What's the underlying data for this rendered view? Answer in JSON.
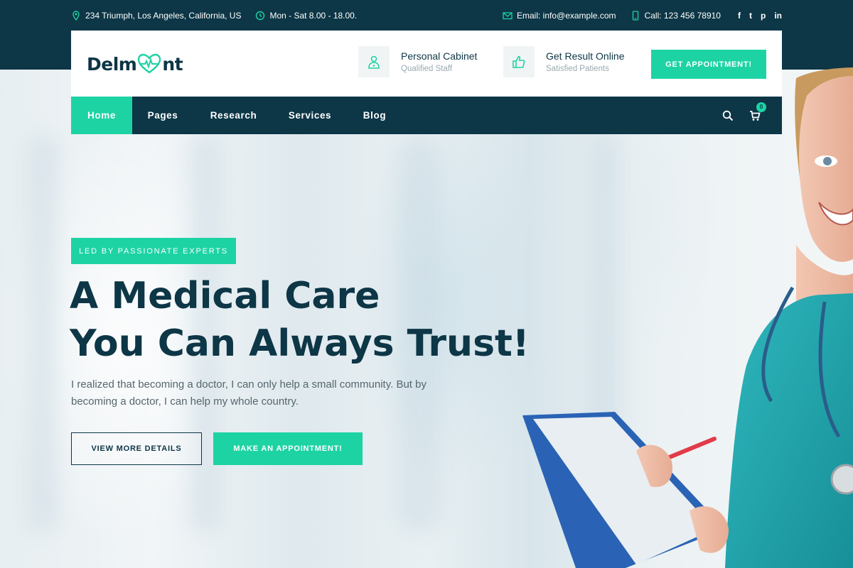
{
  "topbar": {
    "address": "234 Triumph, Los Angeles, California, US",
    "hours": "Mon - Sat 8.00 - 18.00.",
    "email": "Email: info@example.com",
    "phone": "Call: 123 456 78910",
    "socials": [
      "f",
      "t",
      "p",
      "in"
    ]
  },
  "header": {
    "logo_left": "Delm",
    "logo_right": "nt",
    "info": [
      {
        "title": "Personal Cabinet",
        "subtitle": "Qualified Staff",
        "icon": "doctor-icon"
      },
      {
        "title": "Get Result Online",
        "subtitle": "Satisfied Patients",
        "icon": "thumbs-up-icon"
      }
    ],
    "appointment_label": "GET APPOINTMENT!"
  },
  "nav": {
    "items": [
      {
        "label": "Home",
        "active": true
      },
      {
        "label": "Pages",
        "active": false
      },
      {
        "label": "Research",
        "active": false
      },
      {
        "label": "Services",
        "active": false
      },
      {
        "label": "Blog",
        "active": false
      }
    ],
    "cart_count": "0"
  },
  "hero": {
    "tag": "LED BY PASSIONATE EXPERTS",
    "headline_line1": "A Medical Care",
    "headline_line2": "You Can Always Trust!",
    "paragraph": "I realized that becoming a doctor, I can only help a small community. But by becoming a doctor, I can help my whole country.",
    "details_label": "VIEW MORE DETAILS",
    "appointment_label": "MAKE AN APPOINTMENT!"
  },
  "colors": {
    "primary": "#0d3646",
    "accent": "#1dd3a4",
    "text_muted": "#55666e"
  }
}
